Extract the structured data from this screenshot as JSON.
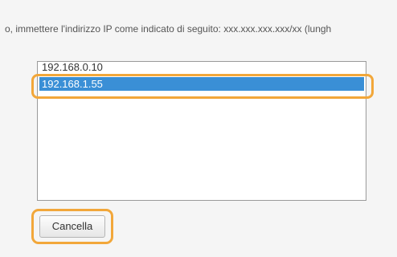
{
  "instruction_text": "o, immettere l'indirizzo IP come indicato di seguito: xxx.xxx.xxx.xxx/xx (lungh",
  "ip_list": {
    "items": [
      "192.168.0.10",
      "192.168.1.55"
    ],
    "selected": "192.168.1.55"
  },
  "cancel_button": {
    "label": "Cancella"
  },
  "colors": {
    "highlight_outline": "#f2a73a",
    "selection": "#3a8fd6"
  }
}
